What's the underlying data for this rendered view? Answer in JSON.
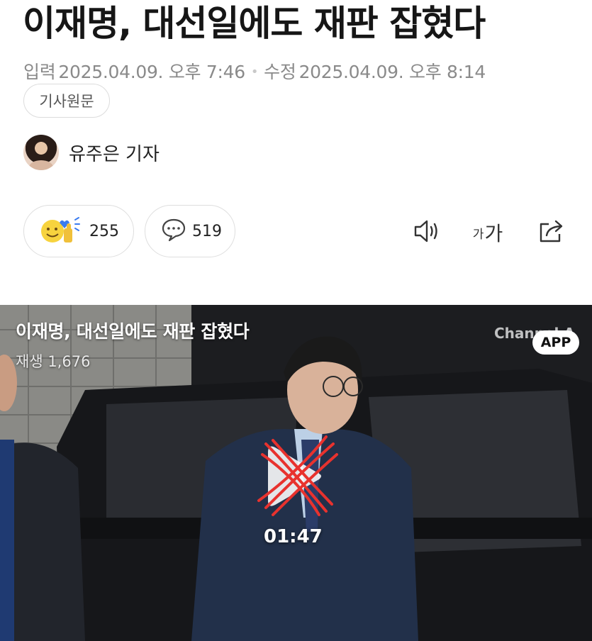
{
  "article": {
    "headline": "이재명, 대선일에도 재판 잡혔다",
    "input_label": "입력",
    "input_date": "2025.04.09. 오후 7:46",
    "modified_label": "수정",
    "modified_date": "2025.04.09. 오후 8:14",
    "original_button": "기사원문",
    "reporter_name": "유주은 기자"
  },
  "actions": {
    "reaction_count": "255",
    "comment_count": "519",
    "font_label_small": "가",
    "font_label_large": "가"
  },
  "icons": {
    "reaction": "smiley-thumbs-icon",
    "comment": "speech-bubble-icon",
    "audio": "speaker-icon",
    "share": "share-icon",
    "play": "play-icon"
  },
  "video": {
    "title": "이재명, 대선일에도 재판 잡혔다",
    "views": "재생 1,676",
    "channel_logo": "Channel A",
    "app_button": "APP",
    "duration": "01:47"
  },
  "colors": {
    "accent_red": "#e8322e",
    "reaction_yellow": "#f7d33e",
    "reaction_blue": "#3a7bf0"
  }
}
